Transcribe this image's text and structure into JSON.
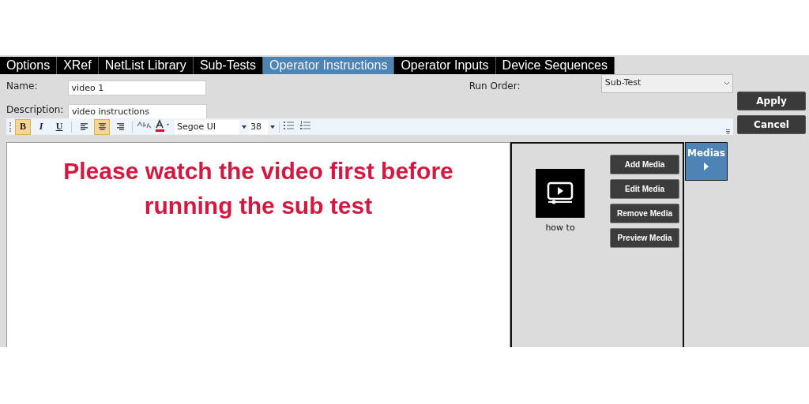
{
  "tabs": [
    {
      "label": "Options",
      "selected": false
    },
    {
      "label": "XRef",
      "selected": false
    },
    {
      "label": "NetList Library",
      "selected": false
    },
    {
      "label": "Sub-Tests",
      "selected": false
    },
    {
      "label": "Operator Instructions",
      "selected": true
    },
    {
      "label": "Operator Inputs",
      "selected": false
    },
    {
      "label": "Device Sequences",
      "selected": false
    }
  ],
  "form": {
    "name_label": "Name:",
    "name_value": "video 1",
    "description_label": "Description:",
    "description_value": "video instructions",
    "run_order_label": "Run Order:",
    "run_order_value": "Sub-Test"
  },
  "buttons": [
    "Apply",
    "Cancel"
  ],
  "toolbar": {
    "items": [
      {
        "kind": "bold",
        "label": "B",
        "selected": true
      },
      {
        "kind": "italic",
        "label": "I",
        "selected": false
      },
      {
        "kind": "underline",
        "label": "U",
        "selected": false
      },
      {
        "kind": "align-left",
        "selected": false
      },
      {
        "kind": "align-center",
        "selected": true
      },
      {
        "kind": "align-right",
        "selected": false
      }
    ],
    "font": "Segoe UI",
    "size": "38"
  },
  "editor": {
    "text": "Please watch the video first before running the sub test"
  },
  "media": {
    "items": [
      {
        "label": "how to"
      }
    ],
    "buttons": [
      "Add Media",
      "Edit Media",
      "Remove Media",
      "Preview Media"
    ],
    "tab_label": "Medias"
  }
}
